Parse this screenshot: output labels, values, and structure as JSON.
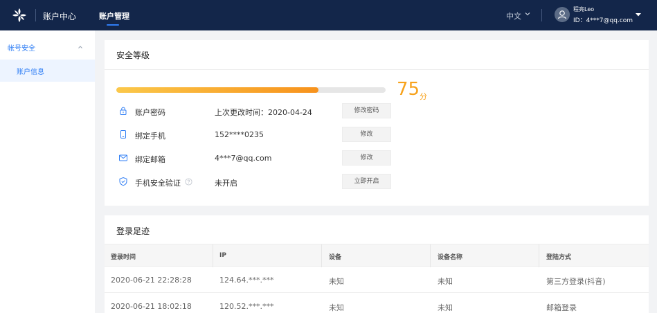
{
  "header": {
    "app_title": "账户中心",
    "nav_tab": "账户管理",
    "language": "中文",
    "user_name": "程亮Leo",
    "user_id": "ID：4***7@qq.com",
    "accent_color": "#2f7ef5",
    "bg_color": "#13264a"
  },
  "sidebar": {
    "group_label": "帐号安全",
    "items": [
      {
        "label": "账户信息",
        "active": true
      }
    ]
  },
  "security": {
    "title": "安全等级",
    "progress_percent": 75,
    "score": "75",
    "score_unit": "分",
    "rows": [
      {
        "icon": "lock-icon",
        "label": "账户密码",
        "value": "上次更改时间：2020-04-24",
        "button": "修改密码",
        "help": false
      },
      {
        "icon": "phone-icon",
        "label": "绑定手机",
        "value": "152****0235",
        "button": "修改",
        "help": false
      },
      {
        "icon": "mail-icon",
        "label": "绑定邮箱",
        "value": "4***7@qq.com",
        "button": "修改",
        "help": false
      },
      {
        "icon": "shield-icon",
        "label": "手机安全验证",
        "value": "未开启",
        "button": "立即开启",
        "help": true
      }
    ]
  },
  "login": {
    "title": "登录足迹",
    "columns": [
      "登录时间",
      "IP",
      "设备",
      "设备名称",
      "登陆方式"
    ],
    "rows": [
      [
        "2020-06-21 22:28:28",
        "124.64.***.***",
        "未知",
        "未知",
        "第三方登录(抖音)"
      ],
      [
        "2020-06-21 18:02:18",
        "120.52.***.***",
        "未知",
        "未知",
        "邮箱登录"
      ]
    ]
  }
}
